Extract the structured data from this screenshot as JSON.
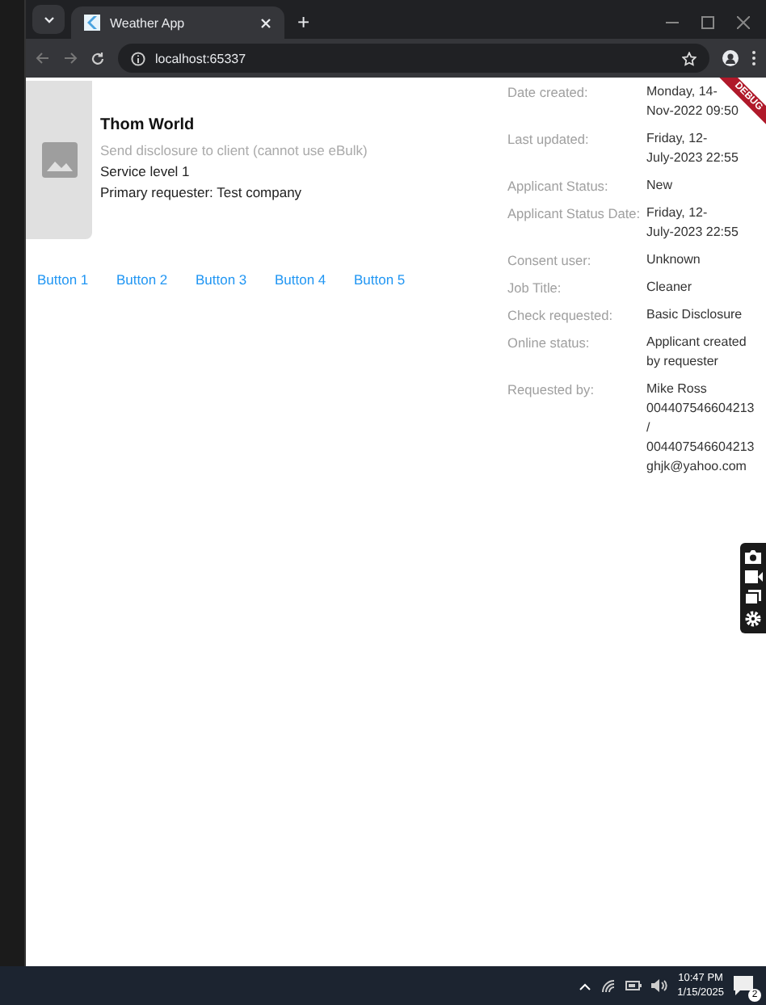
{
  "browser": {
    "tab_title": "Weather App",
    "new_tab": "+",
    "address": "localhost:65337"
  },
  "card": {
    "title": "Thom World",
    "subtitle": "Send disclosure to client (cannot use eBulk)",
    "lines": [
      "Service level 1",
      "Primary requester: Test company"
    ]
  },
  "buttons": [
    "Button 1",
    "Button 2",
    "Button 3",
    "Button 4",
    "Button 5"
  ],
  "details": [
    {
      "label": "Date created:",
      "value": "Monday, 14-\nNov-2022 09:50"
    },
    {
      "label": "Last updated:",
      "value": "Friday, 12-\nJuly-2023 22:55"
    },
    {
      "label": "Applicant Status:",
      "value": "New"
    },
    {
      "label": "Applicant Status Date:",
      "value": "Friday, 12-\nJuly-2023 22:55"
    },
    {
      "label": "Consent user:",
      "value": "Unknown"
    },
    {
      "label": "Job Title:",
      "value": "Cleaner"
    },
    {
      "label": "Check requested:",
      "value": "Basic Disclosure"
    },
    {
      "label": "Online status:",
      "value": "Applicant created\nby requester"
    },
    {
      "label": "Requested by:",
      "value": "Mike Ross\n004407546604213\n/\n004407546604213\nghjk@yahoo.com"
    }
  ],
  "debug_banner": "DEBUG",
  "taskbar": {
    "time": "10:47 PM",
    "date": "1/15/2025",
    "notifications": "2"
  }
}
